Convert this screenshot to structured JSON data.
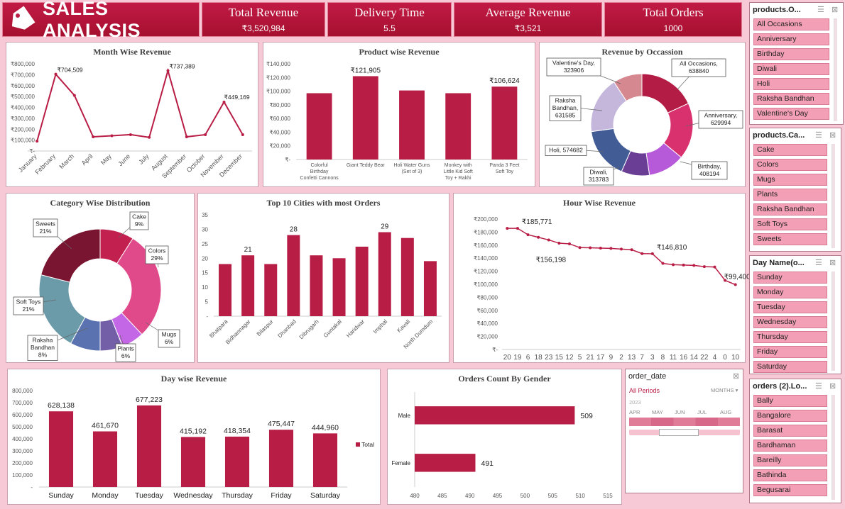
{
  "header": {
    "title": "SALES ANALYSIS",
    "tag_icon": "tag-icon"
  },
  "kpis": [
    {
      "label": "Total Revenue",
      "value": "₹3,520,984"
    },
    {
      "label": "Delivery Time",
      "value": "5.5"
    },
    {
      "label": "Average Revenue",
      "value": "₹3,521"
    },
    {
      "label": "Total Orders",
      "value": "1000"
    }
  ],
  "colors": {
    "accent": "#b81d45",
    "background": "#f7c9d6",
    "slicer_item": "#f3a0b6"
  },
  "slicers": {
    "occasion": {
      "header": "products.O...",
      "items": [
        "All Occasions",
        "Anniversary",
        "Birthday",
        "Diwali",
        "Holi",
        "Raksha Bandhan",
        "Valentine's Day"
      ]
    },
    "category": {
      "header": "products.Ca...",
      "items": [
        "Cake",
        "Colors",
        "Mugs",
        "Plants",
        "Raksha Bandhan",
        "Soft Toys",
        "Sweets"
      ]
    },
    "dayname": {
      "header": "Day Name(o...",
      "items": [
        "Sunday",
        "Monday",
        "Tuesday",
        "Wednesday",
        "Thursday",
        "Friday",
        "Saturday"
      ]
    },
    "location": {
      "header": "orders (2).Lo...",
      "items": [
        "Bally",
        "Bangalore",
        "Barasat",
        "Bardhaman",
        "Bareilly",
        "Bathinda",
        "Begusarai"
      ]
    },
    "timeline": {
      "header": "order_date",
      "period": "All Periods",
      "unit": "MONTHS",
      "year": "2023",
      "months": [
        "APR",
        "MAY",
        "JUN",
        "JUL",
        "AUG"
      ]
    }
  },
  "chart_data": [
    {
      "type": "line",
      "title": "Month Wise Revenue",
      "categories": [
        "January",
        "February",
        "March",
        "April",
        "May",
        "June",
        "July",
        "August",
        "September",
        "October",
        "November",
        "December"
      ],
      "values": [
        90000,
        704509,
        510000,
        130000,
        140000,
        150000,
        125000,
        737389,
        130000,
        150000,
        449169,
        150000
      ],
      "yticks": [
        "₹800,000",
        "₹700,000",
        "₹600,000",
        "₹500,000",
        "₹400,000",
        "₹300,000",
        "₹200,000",
        "₹100,000",
        "₹-"
      ],
      "ylim": [
        0,
        800000
      ],
      "labels": [
        {
          "index": 1,
          "text": "₹704,509"
        },
        {
          "index": 7,
          "text": "₹737,389"
        },
        {
          "index": 10,
          "text": "₹449,169"
        }
      ]
    },
    {
      "type": "bar",
      "title": "Product wise Revenue",
      "categories": [
        "Colorful Birthday Confetti Cannons",
        "Giant Teddy Bear",
        "Holi Water Guns (Set of 3)",
        "Monkey with Little Kid Soft Toy + Rakhi",
        "Panda 3 Feet Soft Toy"
      ],
      "values": [
        97000,
        121905,
        101000,
        97000,
        106624
      ],
      "yticks": [
        "₹140,000",
        "₹120,000",
        "₹100,000",
        "₹80,000",
        "₹60,000",
        "₹40,000",
        "₹20,000",
        "₹-"
      ],
      "ylim": [
        0,
        140000
      ],
      "labels": [
        {
          "index": 1,
          "text": "₹121,905"
        },
        {
          "index": 4,
          "text": "₹106,624"
        }
      ]
    },
    {
      "type": "pie",
      "title": "Revenue by Occassion",
      "slices": [
        {
          "name": "All Occasions",
          "value": 638840,
          "label": "All Occasions, 638840"
        },
        {
          "name": "Anniversary",
          "value": 629994,
          "label": "Anniversary, 629994"
        },
        {
          "name": "Birthday",
          "value": 408194,
          "label": "Birthday, 408194"
        },
        {
          "name": "Diwali",
          "value": 313783,
          "label": "Diwali, 313783"
        },
        {
          "name": "Holi",
          "value": 574682,
          "label": "Holi, 574682"
        },
        {
          "name": "Raksha Bandhan",
          "value": 631585,
          "label": "Raksha Bandhan, 631585"
        },
        {
          "name": "Valentine's Day",
          "value": 323906,
          "label": "Valentine's Day, 323906"
        }
      ],
      "colors": [
        "#b31c44",
        "#d9306e",
        "#b75ad9",
        "#6b3e96",
        "#425d96",
        "#c5b6dc",
        "#d58890"
      ]
    },
    {
      "type": "pie",
      "title": "Category Wise Distribution",
      "slices": [
        {
          "name": "Cake",
          "value": 9
        },
        {
          "name": "Colors",
          "value": 29
        },
        {
          "name": "Mugs",
          "value": 6
        },
        {
          "name": "Plants",
          "value": 6
        },
        {
          "name": "Raksha Bandhan",
          "value": 8
        },
        {
          "name": "Soft Toys",
          "value": 21
        },
        {
          "name": "Sweets",
          "value": 21
        }
      ],
      "colors": [
        "#c2204f",
        "#e0498a",
        "#c467e6",
        "#735fa8",
        "#5a73b0",
        "#6b9aa8",
        "#7a1531"
      ]
    },
    {
      "type": "bar",
      "title": "Top 10 Cities with most Orders",
      "categories": [
        "Bhatpara",
        "Bidhannagar",
        "Bilaspur",
        "Dhanbad",
        "Dibrugarh",
        "Guntakal",
        "Haridwar",
        "Imphal",
        "Kavali",
        "North Dumdum"
      ],
      "values": [
        18,
        21,
        18,
        28,
        21,
        20,
        24,
        29,
        27,
        19
      ],
      "yticks": [
        "35",
        "30",
        "25",
        "20",
        "15",
        "10",
        "5",
        "-"
      ],
      "ylim": [
        0,
        35
      ],
      "labels": [
        {
          "index": 1,
          "text": "21"
        },
        {
          "index": 3,
          "text": "28"
        },
        {
          "index": 7,
          "text": "29"
        }
      ]
    },
    {
      "type": "line",
      "title": "Hour Wise Revenue",
      "categories": [
        "20",
        "19",
        "6",
        "18",
        "23",
        "15",
        "12",
        "5",
        "21",
        "17",
        "9",
        "2",
        "13",
        "7",
        "3",
        "8",
        "11",
        "16",
        "14",
        "22",
        "4",
        "0",
        "10"
      ],
      "values": [
        185771,
        185771,
        176000,
        172000,
        168000,
        163000,
        162000,
        156198,
        156000,
        155500,
        155000,
        154000,
        153000,
        147000,
        146810,
        132000,
        130000,
        129500,
        129000,
        127000,
        126500,
        106000,
        99400
      ],
      "yticks": [
        "₹200,000",
        "₹180,000",
        "₹160,000",
        "₹140,000",
        "₹120,000",
        "₹100,000",
        "₹80,000",
        "₹60,000",
        "₹40,000",
        "₹20,000",
        "₹-"
      ],
      "ylim": [
        0,
        200000
      ],
      "labels": [
        {
          "index": 1,
          "text": "₹185,771"
        },
        {
          "index": 7,
          "text": "₹156,198"
        },
        {
          "index": 14,
          "text": "₹146,810"
        },
        {
          "index": 22,
          "text": "₹99,400"
        }
      ]
    },
    {
      "type": "bar",
      "title": "Day wise Revenue",
      "categories": [
        "Sunday",
        "Monday",
        "Tuesday",
        "Wednesday",
        "Thursday",
        "Friday",
        "Saturday"
      ],
      "values": [
        628138,
        461670,
        677223,
        415192,
        418354,
        475447,
        444960
      ],
      "value_labels": [
        "628,138",
        "461,670",
        "677,223",
        "415,192",
        "418,354",
        "475,447",
        "444,960"
      ],
      "yticks": [
        "800,000",
        "700,000",
        "600,000",
        "500,000",
        "400,000",
        "300,000",
        "200,000",
        "100,000",
        "-"
      ],
      "ylim": [
        0,
        800000
      ],
      "legend": "Total"
    },
    {
      "type": "bar",
      "title": "Orders Count By Gender",
      "categories": [
        "Male",
        "Female"
      ],
      "values": [
        509,
        491
      ],
      "value_labels": [
        "509",
        "491"
      ],
      "xticks": [
        "480",
        "485",
        "490",
        "495",
        "500",
        "505",
        "510",
        "515"
      ],
      "xlim": [
        480,
        515
      ]
    }
  ]
}
